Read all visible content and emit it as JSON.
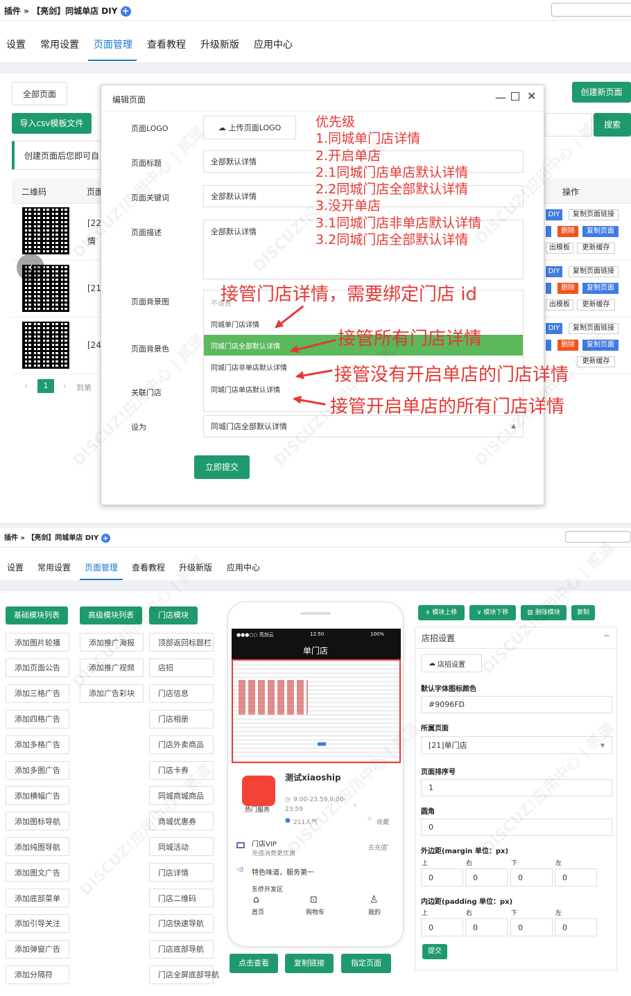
{
  "top1": {
    "crumb_prefix": "插件 »",
    "crumb_title": "【亮剑】同城单店 DIY"
  },
  "nav": [
    "设置",
    "常用设置",
    "页面管理",
    "查看教程",
    "升级新版",
    "应用中心"
  ],
  "list": {
    "tab_all": "全部页面",
    "create_btn": "创建新页面",
    "import_btn": "导入csv模板文件",
    "search_btn": "搜索",
    "tip": "创建页面后您即可自",
    "col_qr": "二维码",
    "col_page": "页面",
    "col_ops": "操作",
    "rows": [
      {
        "id": "[22",
        "sub": "情"
      },
      {
        "id": "[21",
        "sub": ""
      },
      {
        "id": "[24",
        "sub": ""
      }
    ],
    "ops_diy": "DIY",
    "ops_copylink": "复制页面链接",
    "ops_del": "删除",
    "ops_copypage": "复制页面",
    "ops_export": "出模板",
    "ops_cache": "更新缓存",
    "page_num": "1",
    "goto": "到第"
  },
  "modal": {
    "title": "编辑页面",
    "logo_label": "页面LOGO",
    "logo_btn": "上传页面LOGO",
    "title_label": "页面标题",
    "title_val": "全部默认详情",
    "kw_label": "页面关键词",
    "kw_val": "全部默认详情",
    "desc_label": "页面描述",
    "desc_val": "全部默认详情",
    "bgimg_label": "页面背景图",
    "bgcolor_label": "页面背景色",
    "store_label": "关联门店",
    "setas_label": "设为",
    "options": [
      "不设置",
      "同城单门店详情",
      "同城门店全部默认详情",
      "同城门店非单店默认详情",
      "同城门店单店默认详情"
    ],
    "setas_val": "同城门店全部默认详情",
    "submit": "立即提交"
  },
  "annot": {
    "priority": [
      "优先级",
      "1.同城单门店详情",
      "2.开启单店",
      "2.1同城门店单店默认详情",
      "2.2同城门店全部默认详情",
      "3.没开单店",
      "3.1同城门店非单店默认详情",
      "3.2同城门店全部默认详情"
    ],
    "a1": "接管门店详情，需要绑定门店 id",
    "a2": "接管所有门店详情",
    "a3": "接管没有开启单店的门店详情",
    "a4": "接管开启单店的所有门店详情"
  },
  "top2": {
    "crumb_prefix": "插件 »",
    "crumb_title": "【亮剑】同城单店 DIY"
  },
  "diy": {
    "tab_basic": "基础模块列表",
    "tab_adv": "高级模块列表",
    "tab_store": "门店模块",
    "col1": [
      "添加图片轮播",
      "添加页面公告",
      "添加三格广告",
      "添加四格广告",
      "添加多格广告",
      "添加多图广告",
      "添加横幅广告",
      "添加图标导航",
      "添加纯图导航",
      "添加图文广告",
      "添加底部菜单",
      "添加引导关注",
      "添加弹窗广告",
      "添加分隔符"
    ],
    "col2": [
      "添加推广海报",
      "添加推广视频",
      "添加广告彩块"
    ],
    "col3": [
      "顶部返回标题栏",
      "店招",
      "门店信息",
      "门店相册",
      "门店外卖商品",
      "门店卡券",
      "同城商城商品",
      "商城优惠券",
      "同城活动",
      "门店详情",
      "门店二维码",
      "门店快速导航",
      "门店底部导航",
      "门店全屏底部导航"
    ],
    "phone": {
      "status_left": "●●●○○ 亮剑云",
      "status_time": "12:50",
      "status_right": "100%",
      "title": "单门店",
      "store_name": "测试xiaoship",
      "hot": "热门服务",
      "hours": "9:00-23:59,9:00-",
      "hours2": "23:59",
      "people": "211人气",
      "fav": "收藏",
      "vip": "门店VIP",
      "vip_sub": "充值消费更优惠",
      "recharge": "去充值",
      "slogan": "特色味道，服务第一",
      "area": "东侨开发区",
      "nav_home": "首页",
      "nav_cart": "购物车",
      "nav_mine": "我的"
    },
    "btn_view": "点击查看",
    "btn_copy": "复制链接",
    "btn_assign": "指定页面",
    "tool_up": "模块上移",
    "tool_down": "模块下移",
    "tool_del": "删除模块",
    "tool_copy": "复制",
    "panel_title": "店招设置",
    "upload_btn": "店招设置",
    "icon_color_label": "默认字体图标颜色",
    "icon_color_val": "#9096FD",
    "page_label": "所属页面",
    "page_val": "[21]单门店",
    "sort_label": "页面排序号",
    "sort_val": "1",
    "radius_label": "圆角",
    "radius_val": "0",
    "margin_label": "外边距(margin 单位：px)",
    "padding_label": "内边距(padding 单位：px)",
    "dirs": [
      "上",
      "右",
      "下",
      "左"
    ],
    "zero": "0",
    "submit": "提交"
  },
  "watermark": "DISCUZ!应用中心 | 贰道"
}
